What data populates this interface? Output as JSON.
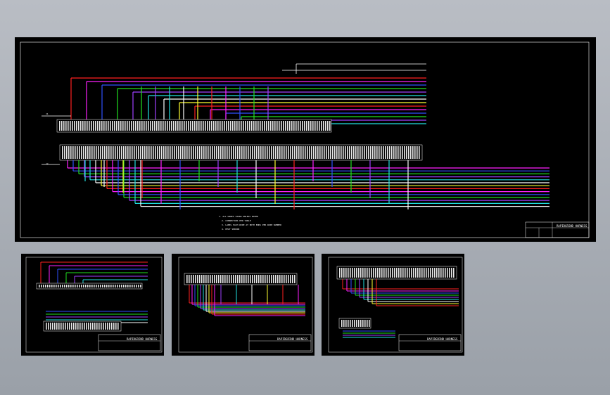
{
  "sheets": [
    {
      "id": "main",
      "title_block": "RAPIDGRIND HARNESS",
      "label_connector_left": "J1",
      "label_connector_bottom": "J2"
    },
    {
      "id": "sheet-2",
      "title_block": "RAPIDGRIND HARNESS"
    },
    {
      "id": "sheet-3",
      "title_block": "RAPIDGRIND HARNESS"
    },
    {
      "id": "sheet-4",
      "title_block": "RAPIDGRIND HARNESS"
    }
  ],
  "notes": [
    "1. ALL WIRES 22AWG UNLESS NOTED",
    "2. CONNECTORS PER TABLE",
    "3. LABEL EACH WIRE AT BOTH ENDS PER WIRE NUMBER",
    "4. HEAT SHRINK"
  ],
  "wire_colors": {
    "red": "#ff2020",
    "green": "#20e020",
    "blue": "#3050ff",
    "magenta": "#ff20ff",
    "cyan": "#20e0e0",
    "yellow": "#ffff30",
    "white": "#ffffff",
    "purple": "#a040ff"
  }
}
